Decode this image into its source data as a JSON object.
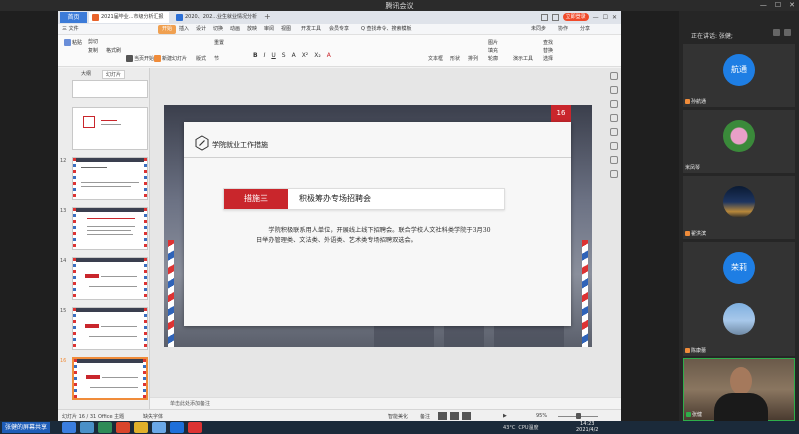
{
  "meeting": {
    "title": "腾讯会议",
    "window_controls": [
      "—",
      "☐",
      "✕"
    ]
  },
  "wps": {
    "home_tab": "首页",
    "tabs": [
      {
        "label": "2021届毕业...市级分析汇报",
        "icon_color": "#e8632b",
        "active": true
      },
      {
        "label": "2020、202...业生就业情况分析",
        "icon_color": "#2b6fd6",
        "active": false
      }
    ],
    "new_tab": "+",
    "login_button": "立即登录",
    "menu": [
      "三 文件",
      "开始",
      "插入",
      "设计",
      "切换",
      "动画",
      "放映",
      "审阅",
      "视图",
      "开发工具",
      "会员专享",
      "Q 查找命令、搜索模板",
      "未同步",
      "协作",
      "分享"
    ],
    "ribbon": {
      "paste": "粘贴",
      "cut": "剪切",
      "copy": "复制",
      "format_painter": "格式刷",
      "from_current": "当页开始",
      "new_slide": "新建幻灯片",
      "layout": "版式",
      "section": "节",
      "reset": "重置",
      "text_box": "文本框",
      "shapes": "形状",
      "arrange": "排列",
      "picture": "图片",
      "fill": "填充",
      "outline": "轮廓",
      "find": "查找",
      "replace": "替换",
      "demo_tools": "演示工具",
      "select": "选择",
      "format_glyphs": [
        "B",
        "I",
        "U",
        "S",
        "A",
        "X²",
        "X₂",
        "A"
      ]
    },
    "thumbs_tabs": {
      "outline": "大纲",
      "slides": "幻灯片"
    },
    "slide_numbers": [
      "12",
      "13",
      "14",
      "15",
      "16"
    ],
    "add_slide": "+",
    "notes_placeholder": "单击此处添加备注",
    "status": {
      "slide_counter": "幻灯片 16 / 31",
      "theme": "Office 主题",
      "missing_font": "缺失字体",
      "beautify": "智能美化",
      "notes": "备注",
      "zoom": "95%"
    }
  },
  "slide": {
    "page_number": "16",
    "section_title": "学院就业工作措施",
    "measure_label": "措施三",
    "measure_title": "积极筹办专场招聘会",
    "body": "学院积极联系用人单位，开展线上线下招聘会。联合学校人文社科类学院于3月30日举办管理类、文法类、外语类、艺术类专场招聘双选会。"
  },
  "panel": {
    "speaking": "正在讲话: 张健;",
    "participants": [
      {
        "name": "孙航通",
        "avatar_text": "航通",
        "kind": "text"
      },
      {
        "name": "米凤琴",
        "avatar_text": "",
        "kind": "photo-flower"
      },
      {
        "name": "翟洪滨",
        "avatar_text": "",
        "kind": "photo-city"
      },
      {
        "name": "荣莉",
        "avatar_text": "荣莉",
        "kind": "text"
      },
      {
        "name": "陈康蕾",
        "avatar_text": "",
        "kind": "photo-tower"
      },
      {
        "name": "张健",
        "avatar_text": "",
        "kind": "video"
      }
    ]
  },
  "taskbar": {
    "share_note": "张健的屏幕共享",
    "weather": "43°C",
    "cpu": "CPU温度",
    "time": "14:23",
    "date": "2021/4/2"
  },
  "colors": {
    "accent_red": "#c9262c",
    "wps_orange": "#f08c3a",
    "meeting_blue": "#1e7ee4"
  }
}
